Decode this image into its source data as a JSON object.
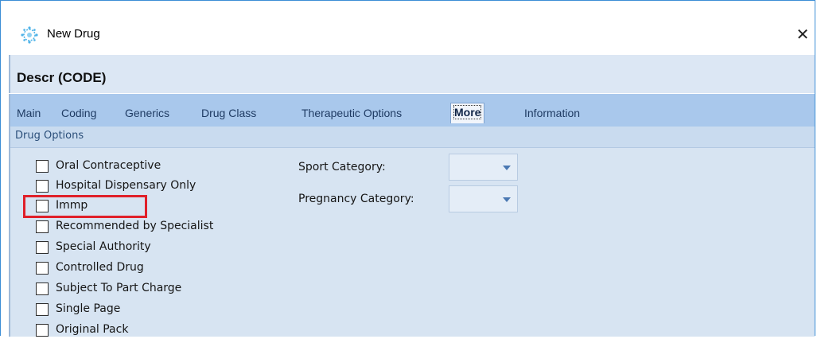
{
  "window": {
    "title": "New Drug",
    "close_glyph": "✕",
    "app_icon": "gear-sparkle-icon"
  },
  "header": {
    "record_title": "Descr (CODE)"
  },
  "tabs": [
    {
      "label": "Main",
      "active": false
    },
    {
      "label": "Coding",
      "active": false
    },
    {
      "label": "Generics",
      "active": false
    },
    {
      "label": "Drug Class",
      "active": false
    },
    {
      "label": "Therapeutic Options",
      "active": false
    },
    {
      "label": "More",
      "active": true
    },
    {
      "label": "Information",
      "active": false
    }
  ],
  "drug_options": {
    "group_title": "Drug Options",
    "checkboxes": [
      {
        "label": "Oral Contraceptive",
        "checked": false
      },
      {
        "label": "Hospital Dispensary Only",
        "checked": false
      },
      {
        "label": "Immp",
        "checked": false
      },
      {
        "label": "Recommended by Specialist",
        "checked": false
      },
      {
        "label": "Special Authority",
        "checked": false
      },
      {
        "label": "Controlled Drug",
        "checked": false
      },
      {
        "label": "Subject To Part Charge",
        "checked": false
      },
      {
        "label": "Single Page",
        "checked": false
      },
      {
        "label": "Original Pack",
        "checked": false
      }
    ],
    "sport_category": {
      "label": "Sport Category:",
      "value": ""
    },
    "pregnancy_category": {
      "label": "Pregnancy Category:",
      "value": ""
    }
  },
  "colors": {
    "accent": "#3c8ed6",
    "tab_strip": "#a9c8ec",
    "content_bg": "#d7e4f2",
    "highlight": "#e0202a"
  }
}
